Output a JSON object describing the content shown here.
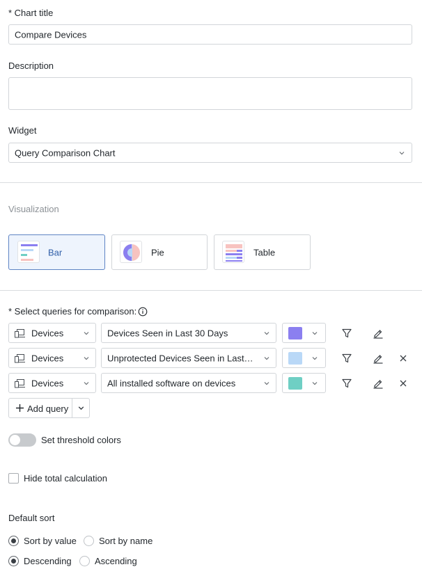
{
  "chart_title": {
    "label": "* Chart title",
    "value": "Compare Devices"
  },
  "description": {
    "label": "Description",
    "value": ""
  },
  "widget": {
    "label": "Widget",
    "value": "Query Comparison Chart"
  },
  "visualization": {
    "label": "Visualization",
    "options": [
      {
        "label": "Bar",
        "selected": true
      },
      {
        "label": "Pie",
        "selected": false
      },
      {
        "label": "Table",
        "selected": false
      }
    ]
  },
  "queries": {
    "label": "* Select queries for comparison:",
    "rows": [
      {
        "type": "Devices",
        "query": "Devices Seen in Last 30 Days",
        "color": "#8b7ff0",
        "removable": false
      },
      {
        "type": "Devices",
        "query": "Unprotected Devices Seen in Last…",
        "color": "#b9d8f7",
        "removable": true
      },
      {
        "type": "Devices",
        "query": "All installed software on devices",
        "color": "#6fcfc4",
        "removable": true
      }
    ],
    "add_label": "Add query"
  },
  "threshold": {
    "label": "Set threshold colors",
    "enabled": false
  },
  "hide_total": {
    "label": "Hide total calculation",
    "checked": false
  },
  "default_sort": {
    "label": "Default sort",
    "by_value": "Sort by value",
    "by_name": "Sort by name",
    "descending": "Descending",
    "ascending": "Ascending",
    "by_selected": "value",
    "order_selected": "descending"
  }
}
